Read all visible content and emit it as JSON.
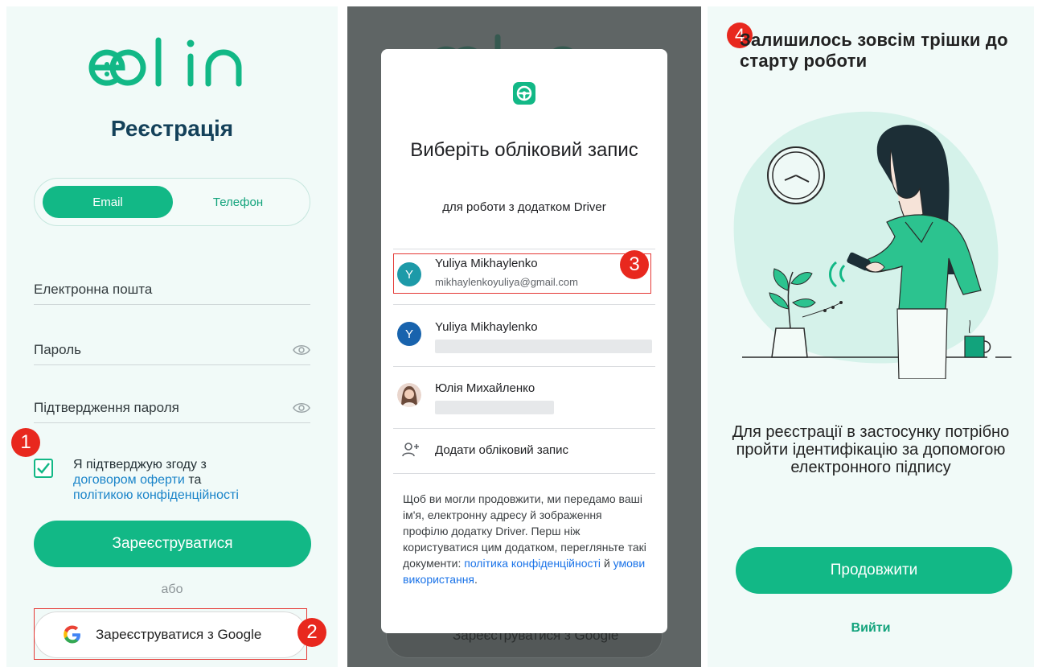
{
  "colors": {
    "accent": "#12b886",
    "dark_title": "#14415a",
    "marker": "#e8281e",
    "link": "#1a84c9"
  },
  "panel1": {
    "logo_text": "edin",
    "title": "Реєстрація",
    "tabs": {
      "active": "Email",
      "inactive": "Телефон"
    },
    "fields": {
      "email": "Електронна пошта",
      "password": "Пароль",
      "confirm": "Підтвердження пароля"
    },
    "eye_icon": "eye-icon",
    "consent": {
      "checked": true,
      "text_1": "Я підтверджую згоду з",
      "link_offer": "договором оферти",
      "text_and": "та",
      "link_privacy": "політикою конфіденційності"
    },
    "register_button": "Зареєструватися",
    "or_label": "або",
    "google_button": "Зареєструватися з Google",
    "markers": {
      "one": "1",
      "two": "2"
    }
  },
  "panel2": {
    "dialog_title": "Виберіть обліковий запис",
    "dialog_subtitle": "для роботи з додатком Driver",
    "accounts": [
      {
        "initial": "Y",
        "name": "Yuliya Mikhaylenko",
        "email": "mikhaylenkoyuliya@gmail.com",
        "avatar_color": "#1d9aa8"
      },
      {
        "initial": "Y",
        "name": "Yuliya Mikhaylenko",
        "email": "",
        "avatar_color": "#1863ad"
      },
      {
        "initial": "",
        "name": "Юлія Михайленко",
        "email": "",
        "avatar_color": "#c9a08d"
      }
    ],
    "add_account": "Додати обліковий запис",
    "info_text": "Щоб ви могли продовжити, ми передамо ваші ім'я, електронну адресу й зображення профілю додатку Driver. Перш ніж користуватися цим додатком, перегляньте такі документи:",
    "link_privacy": "політика конфіденційності",
    "info_and": "й",
    "link_terms": "умови використання",
    "info_end": ".",
    "bg_google_button": "Зареєструватися з Google",
    "marker": "3"
  },
  "panel3": {
    "marker": "4",
    "title": "Залишилось зовсім трішки до старту роботи",
    "description": "Для реєстрації в застосунку потрібно пройти ідентифікацію за допомогою електронного підпису",
    "continue_button": "Продовжити",
    "exit_link": "Вийти"
  }
}
